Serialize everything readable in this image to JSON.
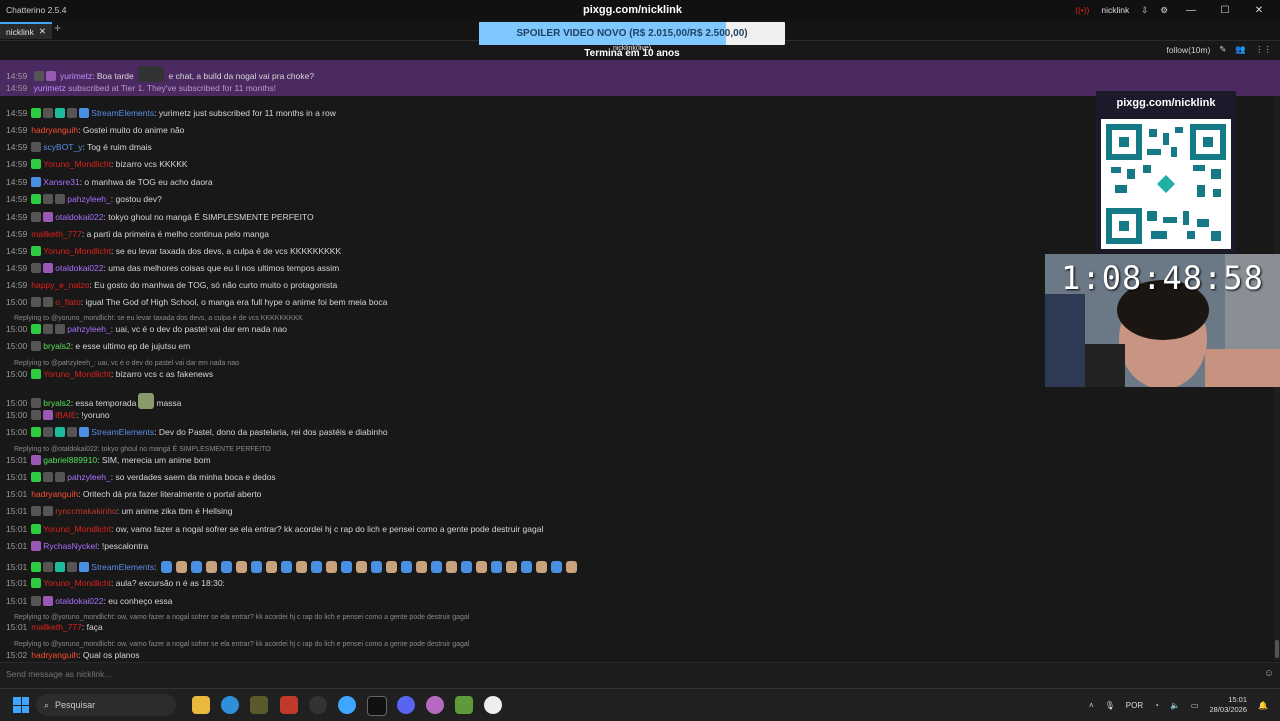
{
  "window": {
    "title": "Chatterino 2.5.4",
    "account": "nicklink"
  },
  "tabs": [
    {
      "label": "nicklink"
    }
  ],
  "channel_bar": {
    "mode": "follow(10m)"
  },
  "banner": {
    "lines": [
      {
        "time": "14:59",
        "user": "yurimetz",
        "text": "Boa tarde",
        "text2": "e chat, a build da nogal vai pra choke?"
      },
      {
        "time": "14:59",
        "user": "yurimetz",
        "text": "subscribed at Tier 1. They've subscribed for 11 months!"
      }
    ]
  },
  "overlay": {
    "site": "pixgg.com/nicklink",
    "spoiler_text": "SPOILER VIDEO NOVO (R$ 2.015,00/R$ 2.500,00)",
    "spoiler_progress": 0.806,
    "spoiler_sub": "nicklink(live)",
    "spoiler_eta": "Termina em 10 anos",
    "qr_title": "pixgg.com/nicklink",
    "timer": "1:08:48:58"
  },
  "colors": {
    "purple": "#a970ff",
    "red": "#e0201a",
    "green": "#55e058",
    "blue": "#5a8fe8",
    "orange": "#ff4d2e",
    "darkred": "#c0392b"
  },
  "messages": [
    {
      "time": "14:59",
      "user": "StreamElements",
      "color": "#5a8fe8",
      "badges": [
        "b-g",
        "b-w",
        "b-t",
        "b-w",
        "b-b"
      ],
      "text": "yurimetz just subscribed for 11 months in a row"
    },
    {
      "time": "14:59",
      "user": "hadryanguih",
      "color": "#ff4d2e",
      "badges": [],
      "text": "Gostei muito do anime não"
    },
    {
      "time": "14:59",
      "user": "scyBOT_y",
      "color": "#5a8fe8",
      "badges": [
        "b-w"
      ],
      "text": "Tog é ruim dmais"
    },
    {
      "time": "14:59",
      "user": "Yoruno_Mondlicht",
      "color": "#e0201a",
      "badges": [
        "b-g"
      ],
      "text": "bizarro vcs KKKKK"
    },
    {
      "time": "14:59",
      "user": "Xansre31",
      "color": "#a970ff",
      "badges": [
        "b-b"
      ],
      "text": "o manhwa de TOG eu acho daora"
    },
    {
      "time": "14:59",
      "user": "pahzyleeh_",
      "color": "#a970ff",
      "badges": [
        "b-g",
        "b-w",
        "b-w"
      ],
      "text": "gostou dev?"
    },
    {
      "time": "14:59",
      "user": "otaldokai022",
      "color": "#a970ff",
      "badges": [
        "b-w",
        "b-p"
      ],
      "text": "tokyo ghoul no mangá É SIMPLESMENTE PERFEITO"
    },
    {
      "time": "14:59",
      "user": "mallketh_777",
      "color": "#e0201a",
      "badges": [],
      "text": "a parti da primeira é melho continua pelo manga"
    },
    {
      "time": "14:59",
      "user": "Yoruno_Mondlicht",
      "color": "#e0201a",
      "badges": [
        "b-g"
      ],
      "text": "se eu levar taxada dos devs, a culpa é de vcs KKKKKKKKK"
    },
    {
      "time": "14:59",
      "user": "otaldokai022",
      "color": "#a970ff",
      "badges": [
        "b-w",
        "b-p"
      ],
      "text": "uma das melhores coisas que eu li nos ultimos tempos assim"
    },
    {
      "time": "14:59",
      "user": "happy_e_natzo",
      "color": "#e0201a",
      "badges": [],
      "text": "Eu gosto do manhwa de TOG, só não curto muito o protagonista"
    },
    {
      "time": "15:00",
      "user": "o_flato",
      "color": "#e0201a",
      "badges": [
        "b-w",
        "b-w"
      ],
      "text": "igual The God of High School, o manga era full hype o anime foi bem meia boca"
    },
    {
      "time": "",
      "reply": true,
      "text": "Replying to @yoruno_mondlicht: se eu levar taxada dos devs, a culpa é de vcs KKKKKKKKK"
    },
    {
      "time": "15:00",
      "user": "pahzyleeh_",
      "color": "#a970ff",
      "badges": [
        "b-g",
        "b-w",
        "b-w"
      ],
      "text": "uai, vc é o dev do pastel vai dar em nada nao"
    },
    {
      "time": "15:00",
      "user": "bryals2",
      "color": "#55e058",
      "badges": [
        "b-w"
      ],
      "text": "e esse ultimo ep de jujutsu em"
    },
    {
      "time": "",
      "reply": true,
      "text": "Replying to @pahzyleeh_: uai, vc é o dev do pastel vai dar em nada nao"
    },
    {
      "time": "15:00",
      "user": "Yoruno_Mondlicht",
      "color": "#e0201a",
      "badges": [
        "b-g"
      ],
      "text": "bizarro vcs c as fakenews"
    },
    {
      "time": "15:00",
      "user": "bryals2",
      "color": "#55e058",
      "badges": [
        "b-w"
      ],
      "text": "essa temporada",
      "text2": "massa"
    },
    {
      "time": "15:00",
      "user": "iBAIE",
      "color": "#e0201a",
      "badges": [
        "b-w",
        "b-p"
      ],
      "text": "!yoruno"
    },
    {
      "time": "15:00",
      "user": "StreamElements",
      "color": "#5a8fe8",
      "badges": [
        "b-g",
        "b-w",
        "b-t",
        "b-w",
        "b-b"
      ],
      "text": "Dev do Pastel, dono da pastelaria, rei dos pastéis e diabinho"
    },
    {
      "time": "",
      "reply": true,
      "text": "Replying to @otaldokai022: tokyo ghoul no mangá É SIMPLESMENTE PERFEITO"
    },
    {
      "time": "15:01",
      "user": "gabriel889910",
      "color": "#55e058",
      "badges": [
        "b-p"
      ],
      "text": "SIM, merecia um anime bom"
    },
    {
      "time": "15:01",
      "user": "pahzyleeh_",
      "color": "#a970ff",
      "badges": [
        "b-g",
        "b-w",
        "b-w"
      ],
      "text": "so verdades saem da minha boca e dedos"
    },
    {
      "time": "15:01",
      "user": "hadryanguih",
      "color": "#ff4d2e",
      "badges": [],
      "text": "Oritech dá pra fazer literalmente o portal aberto"
    },
    {
      "time": "15:01",
      "user": "rynccmakakinho",
      "color": "#c0392b",
      "badges": [
        "b-w",
        "b-w"
      ],
      "text": "um anime zika tbm é Hellsing"
    },
    {
      "time": "15:01",
      "user": "Yoruno_Mondlicht",
      "color": "#e0201a",
      "badges": [
        "b-g"
      ],
      "text": "ow, vamo fazer a nogal sofrer se ela entrar? kk acordei hj c rap do lich e pensei como a gente pode destruir gagal"
    },
    {
      "time": "15:01",
      "user": "RychasNyckel",
      "color": "#a970ff",
      "badges": [
        "b-p"
      ],
      "text": "!pescalontra"
    },
    {
      "time": "15:01",
      "user": "StreamElements",
      "color": "#5a8fe8",
      "badges": [
        "b-g",
        "b-w",
        "b-t",
        "b-w",
        "b-b"
      ],
      "text": "",
      "emote_row": true
    },
    {
      "time": "15:01",
      "user": "Yoruno_Mondlicht",
      "color": "#e0201a",
      "badges": [
        "b-g"
      ],
      "text": "aula? excursão n é as 18:30:"
    },
    {
      "time": "15:01",
      "user": "otaldokai022",
      "color": "#a970ff",
      "badges": [
        "b-w",
        "b-p"
      ],
      "text": "eu conheço essa"
    },
    {
      "time": "",
      "reply": true,
      "text": "Replying to @yoruno_mondlicht: ow, vamo fazer a nogal sofrer se ela entrar? kk acordei hj c rap do lich e pensei como a gente pode destruir gagal"
    },
    {
      "time": "15:01",
      "user": "mallketh_777",
      "color": "#e0201a",
      "badges": [],
      "text": "faça"
    },
    {
      "time": "",
      "reply": true,
      "text": "Replying to @yoruno_mondlicht: ow, vamo fazer a nogal sofrer se ela entrar? kk acordei hj c rap do lich e pensei como a gente pode destruir gagal"
    },
    {
      "time": "15:02",
      "user": "hadryanguih",
      "color": "#ff4d2e",
      "badges": [],
      "text": "Qual os planos"
    }
  ],
  "input": {
    "placeholder": "Send message as nicklink..."
  },
  "taskbar": {
    "search_placeholder": "Pesquisar",
    "lang": "POR",
    "time": "15:01",
    "date": "28/03/2026"
  }
}
